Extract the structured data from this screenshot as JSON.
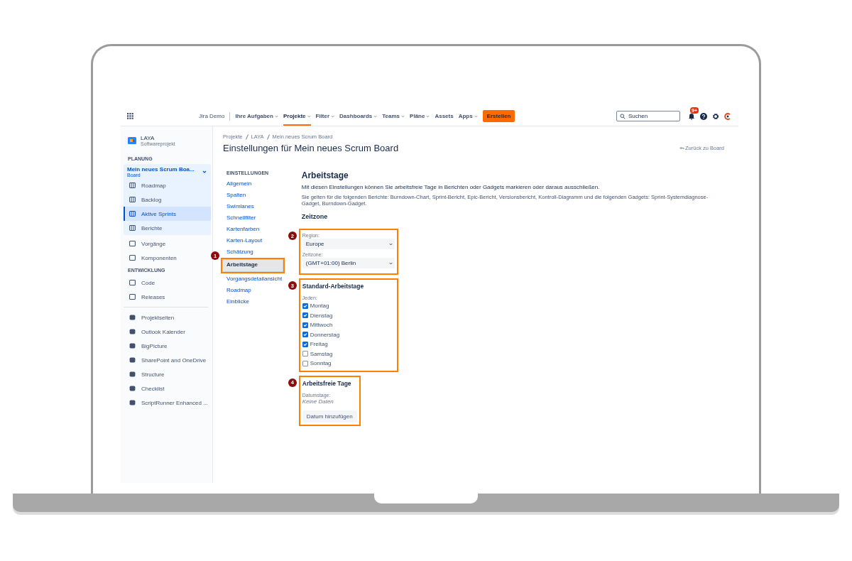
{
  "topbar": {
    "product": "Jira Demo",
    "nav": [
      {
        "label": "Ihre Aufgaben",
        "dropdown": true,
        "selected": false
      },
      {
        "label": "Projekte",
        "dropdown": true,
        "selected": true
      },
      {
        "label": "Filter",
        "dropdown": true,
        "selected": false
      },
      {
        "label": "Dashboards",
        "dropdown": true,
        "selected": false
      },
      {
        "label": "Teams",
        "dropdown": true,
        "selected": false
      },
      {
        "label": "Pläne",
        "dropdown": true,
        "selected": false
      },
      {
        "label": "Assets",
        "dropdown": false,
        "selected": false
      },
      {
        "label": "Apps",
        "dropdown": true,
        "selected": false
      }
    ],
    "create_button": "Erstellen",
    "search": {
      "placeholder": "Suchen"
    },
    "notification_badge": "9+"
  },
  "sidebar": {
    "project": {
      "name": "LAYA",
      "type": "Softwareprojekt"
    },
    "planning_heading": "PLANUNG",
    "board": {
      "name": "Mein neues Scrum Boa...",
      "type": "Board",
      "expanded": true,
      "items": [
        {
          "label": "Roadmap",
          "selected": false
        },
        {
          "label": "Backlog",
          "selected": false
        },
        {
          "label": "Aktive Sprints",
          "selected": true
        },
        {
          "label": "Berichte",
          "selected": false
        }
      ]
    },
    "items": [
      {
        "label": "Vorgänge"
      },
      {
        "label": "Komponenten"
      }
    ],
    "development_heading": "ENTWICKLUNG",
    "development_items": [
      {
        "label": "Code"
      },
      {
        "label": "Releases"
      }
    ],
    "apps": [
      {
        "label": "Projektseiten"
      },
      {
        "label": "Outlook Kalender"
      },
      {
        "label": "BigPicture"
      },
      {
        "label": "SharePoint and OneDrive"
      },
      {
        "label": "Structure"
      },
      {
        "label": "Checklist"
      },
      {
        "label": "ScriptRunner Enhanced ..."
      }
    ]
  },
  "breadcrumbs": [
    "Projekte",
    "LAYA",
    "Mein neues Scrum Board"
  ],
  "page_title": "Einstellungen für Mein neues Scrum Board",
  "back_link": "Zurück zu Board",
  "settings_nav": {
    "heading": "EINSTELLUNGEN",
    "items": [
      {
        "label": "Allgemein",
        "selected": false
      },
      {
        "label": "Spalten",
        "selected": false
      },
      {
        "label": "Swimlanes",
        "selected": false
      },
      {
        "label": "Schnellfilter",
        "selected": false
      },
      {
        "label": "Kartenfarben",
        "selected": false
      },
      {
        "label": "Karten-Layout",
        "selected": false
      },
      {
        "label": "Schätzung",
        "selected": false
      },
      {
        "label": "Arbeitstage",
        "selected": true,
        "marker": "1"
      },
      {
        "label": "Vorgangsdetailansicht",
        "selected": false
      },
      {
        "label": "Roadmap",
        "selected": false
      },
      {
        "label": "Einblicke",
        "selected": false
      }
    ]
  },
  "main": {
    "title": "Arbeitstage",
    "description": "Mit diesen Einstellungen können Sie arbeitsfreie Tage in Berichten oder Gadgets markieren oder daraus ausschließen.",
    "note": "Sie gelten für die folgenden Berichte: Burndown-Chart, Sprint-Bericht, Epic-Bericht, Versionsbericht, Kontroll-Diagramm und die folgenden Gadgets: Sprint-Systemdiagnose-Gadget, Burndown-Gadget.",
    "timezone_heading": "Zeitzone",
    "timezone": {
      "marker": "2",
      "region_label": "Region:",
      "region": "Europe",
      "zone_label": "Zeitzone:",
      "zone": "(GMT+01:00) Berlin"
    },
    "workdays": {
      "marker": "3",
      "title": "Standard-Arbeitstage",
      "label": "Jeden:",
      "days": [
        {
          "label": "Montag",
          "checked": true
        },
        {
          "label": "Dienstag",
          "checked": true
        },
        {
          "label": "Mittwoch",
          "checked": true
        },
        {
          "label": "Donnerstag",
          "checked": true
        },
        {
          "label": "Freitag",
          "checked": true
        },
        {
          "label": "Samstag",
          "checked": false
        },
        {
          "label": "Sonntag",
          "checked": false
        }
      ]
    },
    "holidays": {
      "marker": "4",
      "title": "Arbeitsfreie Tage",
      "label": "Datumstage:",
      "empty": "Keine Daten",
      "button": "Datum hinzufügen"
    }
  }
}
